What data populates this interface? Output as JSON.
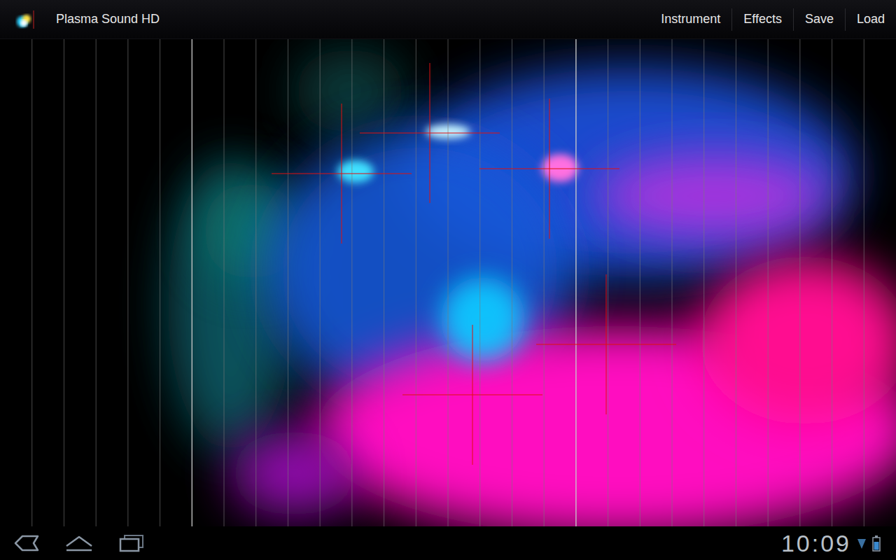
{
  "app": {
    "title": "Plasma Sound HD"
  },
  "menu": [
    {
      "label": "Instrument"
    },
    {
      "label": "Effects"
    },
    {
      "label": "Save"
    },
    {
      "label": "Load"
    }
  ],
  "keyboard": {
    "lines": 27,
    "octave_every": 12
  },
  "status_bar": {
    "clock": "10:09"
  }
}
